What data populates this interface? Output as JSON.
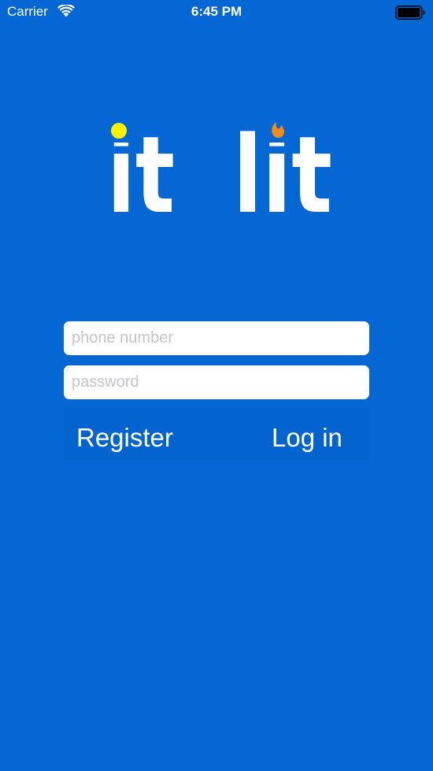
{
  "status_bar": {
    "carrier": "Carrier",
    "time": "6:45 PM",
    "wifi_icon": "wifi-icon",
    "battery_icon": "battery-full-icon"
  },
  "logo": {
    "text_left": "it",
    "text_right": "lit",
    "dot_color": "#FFF200",
    "flame_color": "#F08A1C",
    "flame_icon": "flame-icon"
  },
  "form": {
    "phone_placeholder": "phone number",
    "password_placeholder": "password",
    "phone_value": "",
    "password_value": ""
  },
  "actions": {
    "register_label": "Register",
    "login_label": "Log in"
  },
  "colors": {
    "background": "#0567D3",
    "field_background": "#FFFFFF",
    "placeholder": "#C4C4C9",
    "text": "#FFFFFF"
  }
}
